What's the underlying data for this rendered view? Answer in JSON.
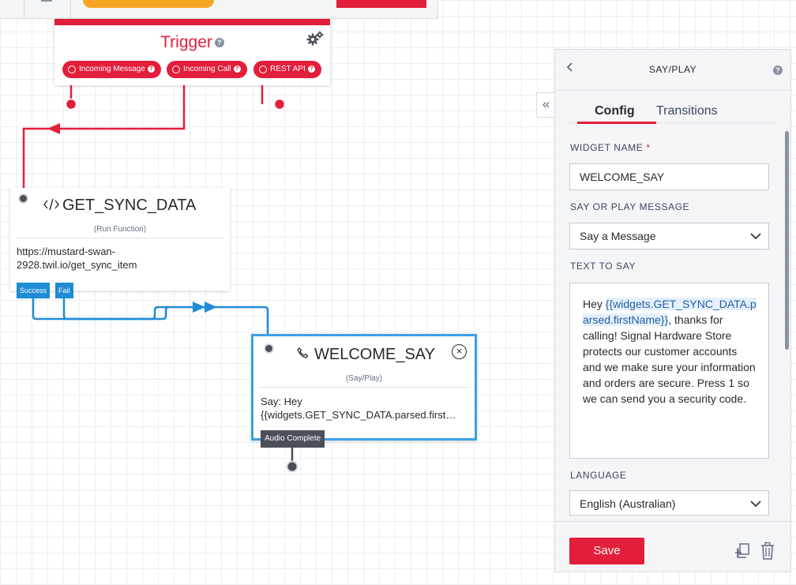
{
  "trigger": {
    "title": "Trigger",
    "help": "?",
    "pills": [
      {
        "label": "Incoming Message"
      },
      {
        "label": "Incoming Call"
      },
      {
        "label": "REST API"
      }
    ]
  },
  "get_sync": {
    "title": "GET_SYNC_DATA",
    "type": "(Run Function)",
    "url_line1": "https://mustard-swan-",
    "url_line2": "2928.twil.io/get_sync_item",
    "success": "Success",
    "fail": "Fail"
  },
  "welcome": {
    "title": "WELCOME_SAY",
    "type": "(Say/Play)",
    "body_line1": "Say: Hey",
    "body_line2": "{{widgets.GET_SYNC_DATA.parsed.first…",
    "audio_complete": "Audio Complete"
  },
  "panel": {
    "title": "SAY/PLAY",
    "help": "?",
    "collapse": "«",
    "tabs": {
      "config": "Config",
      "transitions": "Transitions"
    },
    "widget_name_label": "WIDGET NAME",
    "required_mark": "*",
    "widget_name_value": "WELCOME_SAY",
    "say_play_label": "SAY OR PLAY MESSAGE",
    "say_play_value": "Say a Message",
    "text_label": "TEXT TO SAY",
    "text_before": "Hey ",
    "text_var": "{{widgets.GET_SYNC_DATA.parsed.firstName}}",
    "text_after": ", thanks for calling! Signal Hardware Store protects our customer accounts and we make sure your information and orders are secure. Press 1 so we can send you a security code.",
    "language_label": "LANGUAGE",
    "language_value": "English (Australian)",
    "save": "Save"
  },
  "colors": {
    "brand_red": "#e31e3a",
    "connector_blue": "#1f8cd6",
    "selected_border": "#3ba0e6",
    "toolbar_orange": "#f5a623"
  }
}
